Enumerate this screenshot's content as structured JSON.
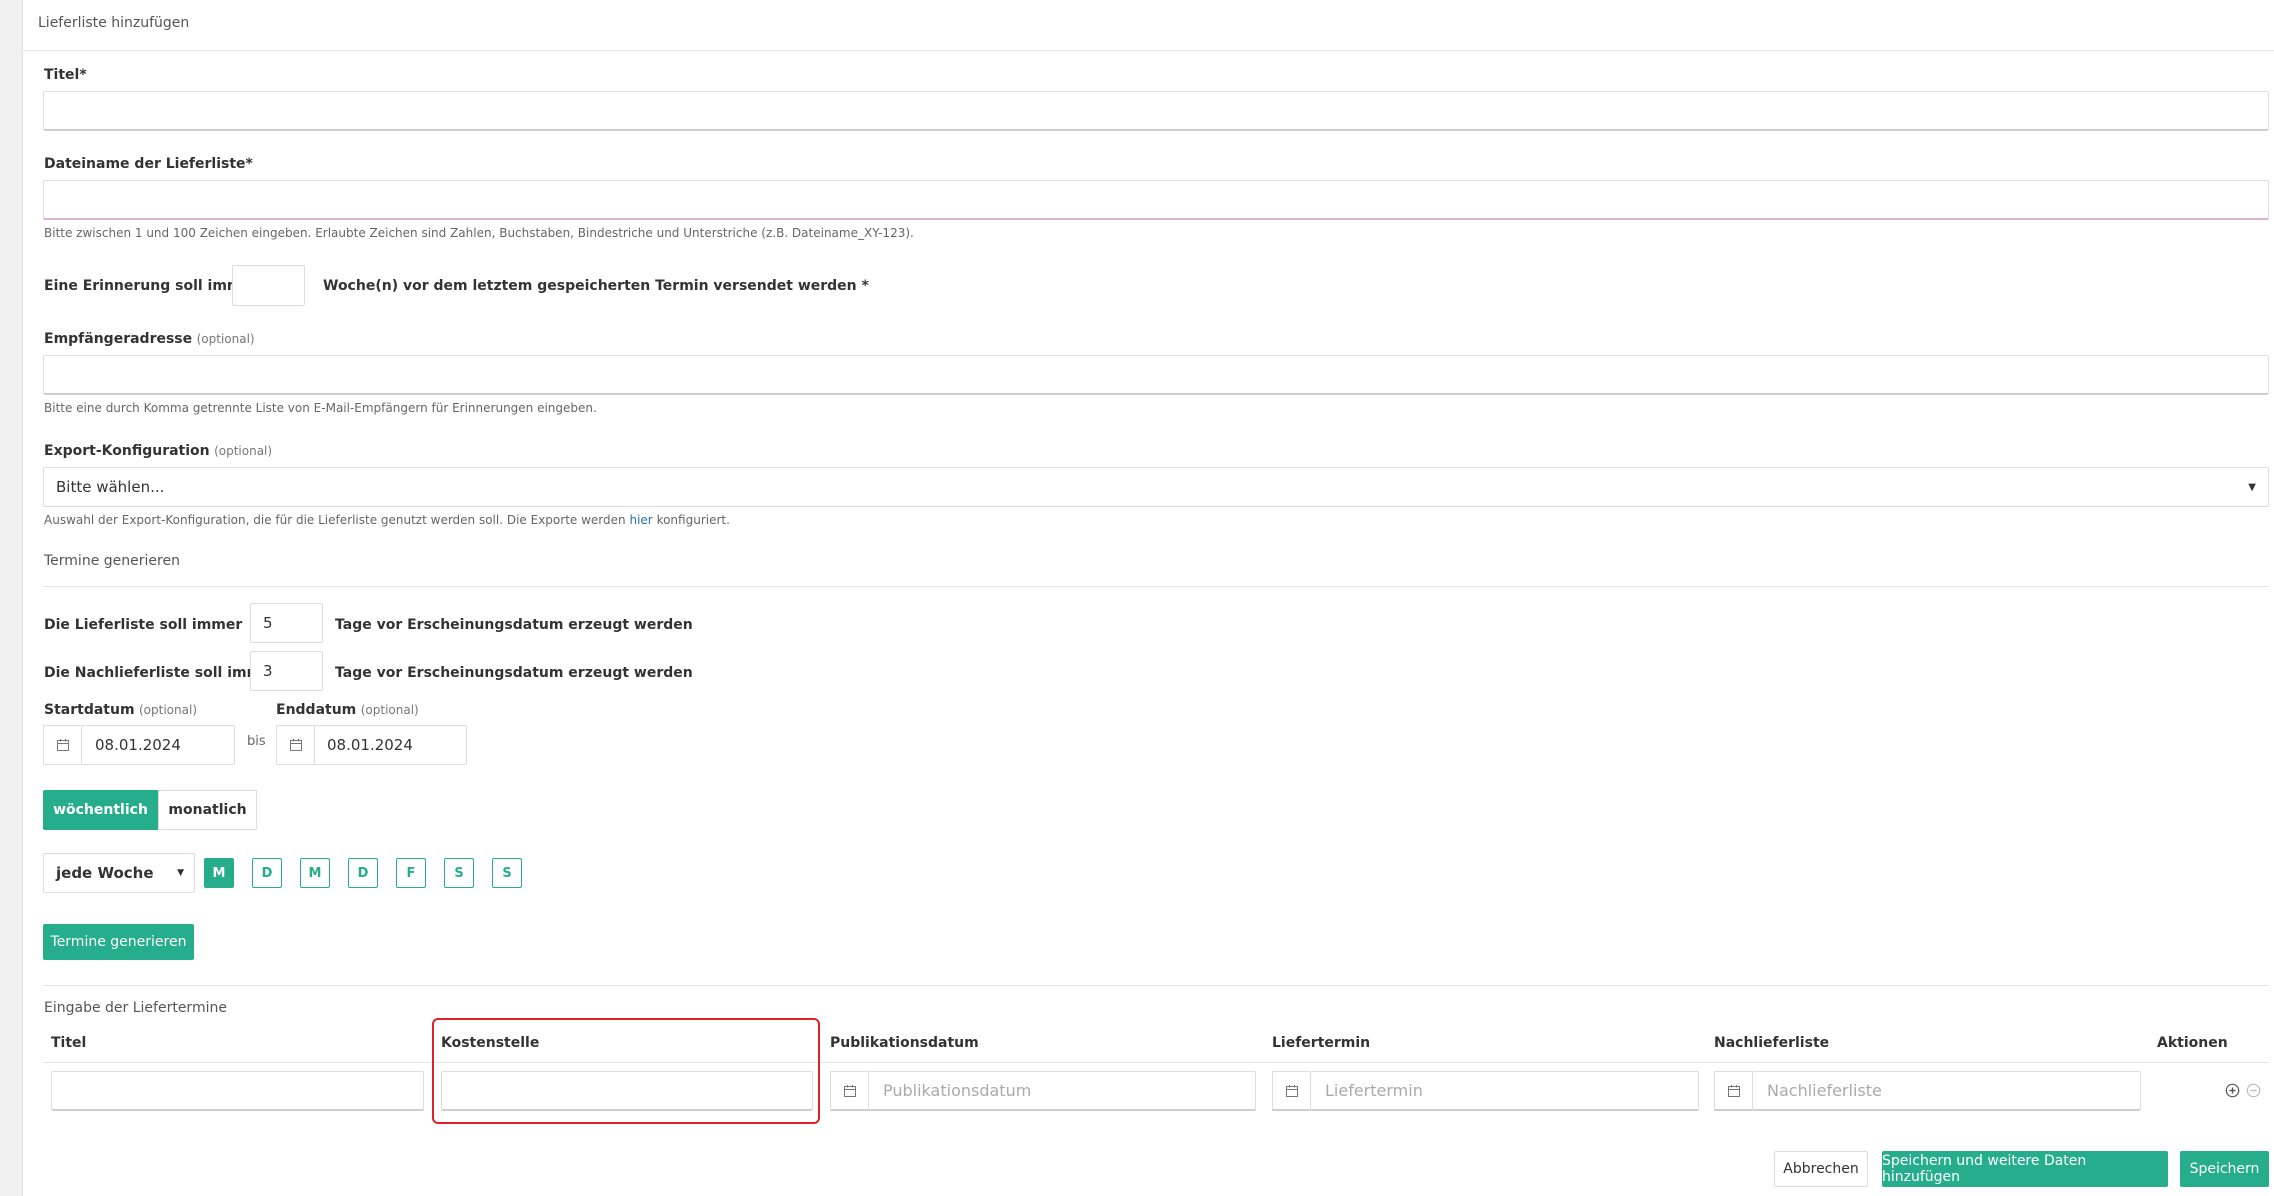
{
  "header": {
    "title": "Lieferliste hinzufügen"
  },
  "fields": {
    "titel_label": "Titel",
    "required_mark": "*",
    "dateiname_label": "Dateiname der Lieferliste",
    "dateiname_hint": "Bitte zwischen 1 und 100 Zeichen eingeben. Erlaubte Zeichen sind Zahlen, Buchstaben, Bindestriche und Unterstriche (z.B. Dateiname_XY-123).",
    "erinnerung_prefix": "Eine Erinnerung soll immer",
    "erinnerung_suffix": "Woche(n) vor dem letztem gespeicherten Termin versendet werden",
    "empfaenger_label": "Empfängeradresse",
    "optional": "(optional)",
    "empfaenger_hint": "Bitte eine durch Komma getrennte Liste von E-Mail-Empfängern für Erinnerungen eingeben.",
    "export_label": "Export-Konfiguration",
    "export_placeholder": "Bitte wählen...",
    "export_hint_before": "Auswahl der Export-Konfiguration, die für die Lieferliste genutzt werden soll. Die Exporte werden",
    "export_hint_link": "hier",
    "export_hint_after": "konfiguriert."
  },
  "termine": {
    "section_title": "Termine generieren",
    "liefer_prefix": "Die Lieferliste soll immer",
    "liefer_value": "5",
    "liefer_suffix": "Tage vor Erscheinungsdatum erzeugt werden",
    "nach_prefix": "Die Nachlieferliste soll immer",
    "nach_value": "3",
    "nach_suffix": "Tage vor Erscheinungsdatum erzeugt werden",
    "start_label": "Startdatum",
    "end_label": "Enddatum",
    "start_value": "08.01.2024",
    "end_value": "08.01.2024",
    "bis": "bis",
    "tab_weekly": "wöchentlich",
    "tab_monthly": "monatlich",
    "frequency": "jede Woche",
    "days": [
      "M",
      "D",
      "M",
      "D",
      "F",
      "S",
      "S"
    ],
    "active_day_index": 0,
    "generate_button": "Termine generieren"
  },
  "liefertermine": {
    "section_title": "Eingabe der Liefertermine",
    "columns": [
      "Titel",
      "Kostenstelle",
      "Publikationsdatum",
      "Liefertermin",
      "Nachlieferliste",
      "Aktionen"
    ],
    "placeholders": {
      "publikationsdatum": "Publikationsdatum",
      "liefertermin": "Liefertermin",
      "nachlieferliste": "Nachlieferliste"
    }
  },
  "footer": {
    "cancel": "Abbrechen",
    "save_more": "Speichern und weitere Daten hinzufügen",
    "save": "Speichern"
  },
  "colors": {
    "accent": "#26ad8c",
    "highlight": "#e0202a",
    "link": "#2a6fb0"
  }
}
